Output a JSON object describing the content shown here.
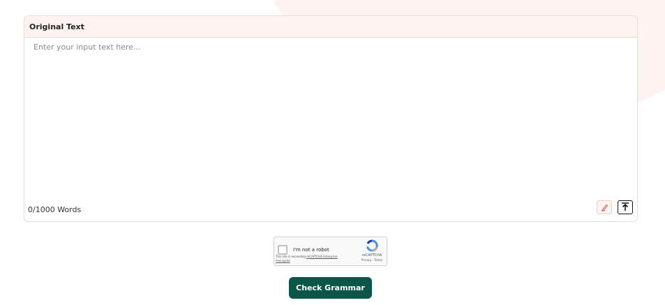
{
  "editor": {
    "title": "Original Text",
    "placeholder": "Enter your input text here...",
    "value": "",
    "word_count": "0/1000 Words",
    "clear_icon": "eraser-icon",
    "upload_icon": "upload-icon"
  },
  "captcha": {
    "label": "I'm not a robot",
    "warning_prefix": "This site is exceeding ",
    "warning_link": "reCAPTCHA Enterprise free quota",
    "brand": "reCAPTCHA",
    "privacy": "Privacy",
    "separator": " - ",
    "terms": "Terms",
    "logo_icon": "recaptcha-logo-icon"
  },
  "actions": {
    "check_label": "Check Grammar"
  },
  "colors": {
    "primary": "#0b5648",
    "header_bg": "#fdf4f1",
    "border": "#e6dcd8"
  }
}
